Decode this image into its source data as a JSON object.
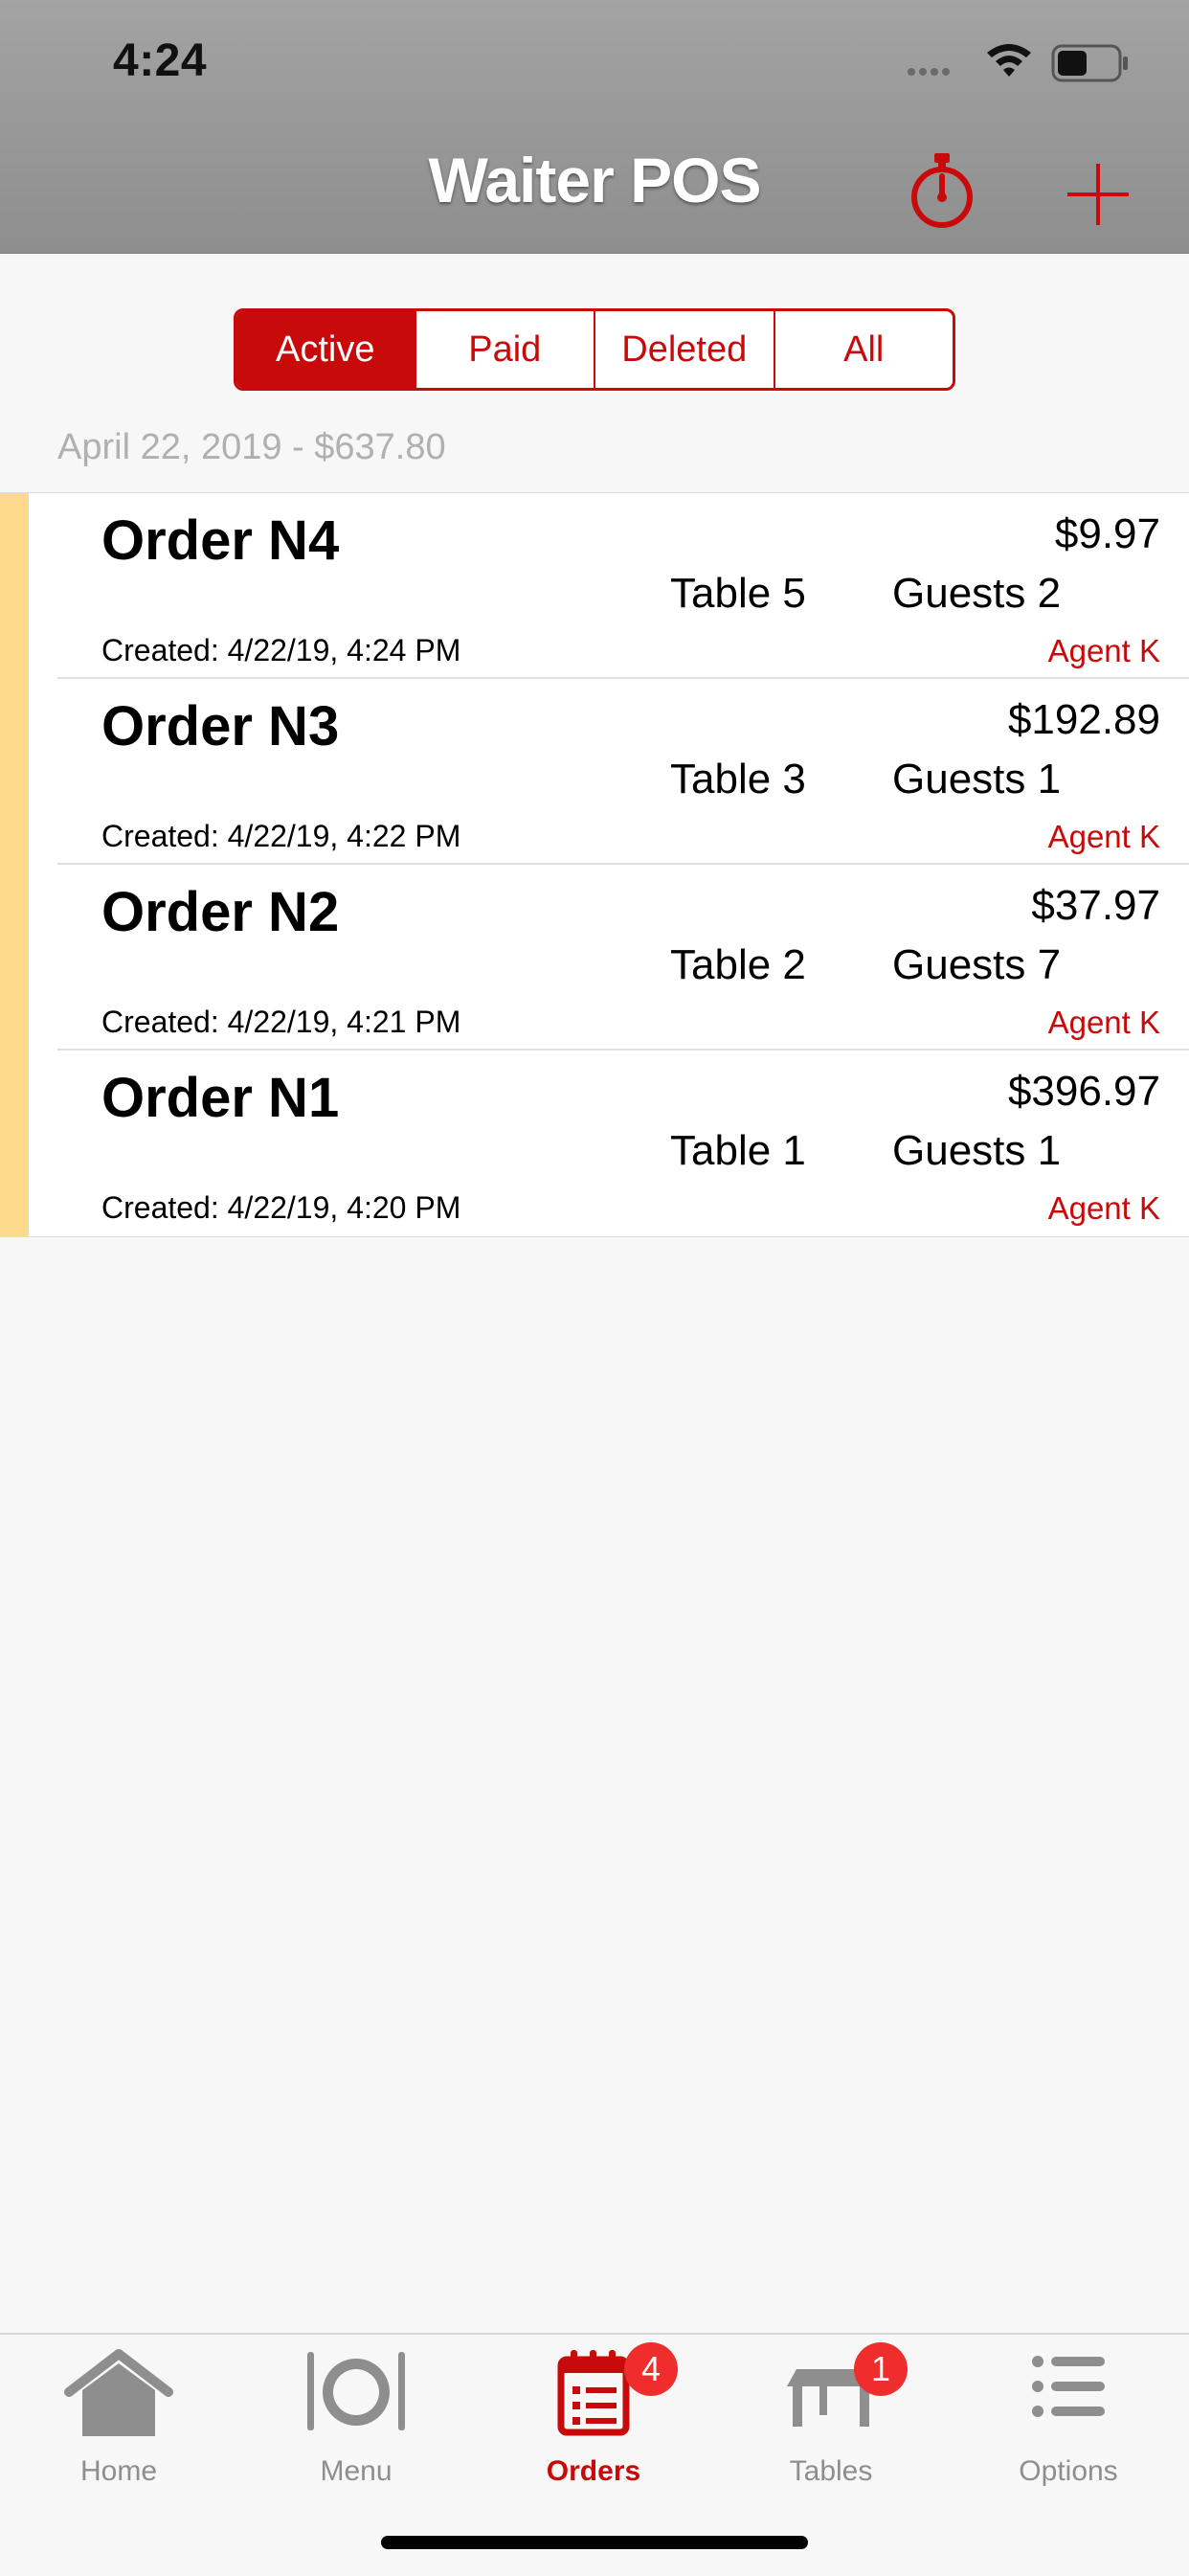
{
  "status_bar": {
    "time": "4:24"
  },
  "nav": {
    "title": "Waiter POS",
    "timer_icon": "stopwatch-icon",
    "add_icon": "plus-icon"
  },
  "segments": [
    {
      "label": "Active",
      "active": true
    },
    {
      "label": "Paid",
      "active": false
    },
    {
      "label": "Deleted",
      "active": false
    },
    {
      "label": "All",
      "active": false
    }
  ],
  "section": {
    "header": "April 22, 2019 - $637.80"
  },
  "orders": [
    {
      "title": "Order N4",
      "price": "$9.97",
      "table": "Table 5",
      "guests": "Guests 2",
      "created": "Created: 4/22/19, 4:24 PM",
      "agent": "Agent K"
    },
    {
      "title": "Order N3",
      "price": "$192.89",
      "table": "Table 3",
      "guests": "Guests 1",
      "created": "Created: 4/22/19, 4:22 PM",
      "agent": "Agent K"
    },
    {
      "title": "Order N2",
      "price": "$37.97",
      "table": "Table 2",
      "guests": "Guests 7",
      "created": "Created: 4/22/19, 4:21 PM",
      "agent": "Agent K"
    },
    {
      "title": "Order N1",
      "price": "$396.97",
      "table": "Table 1",
      "guests": "Guests 1",
      "created": "Created: 4/22/19, 4:20 PM",
      "agent": "Agent K"
    }
  ],
  "tabs": [
    {
      "label": "Home",
      "icon": "house-icon"
    },
    {
      "label": "Menu",
      "icon": "plate-cutlery-icon"
    },
    {
      "label": "Orders",
      "icon": "notepad-icon",
      "badge": "4",
      "active": true
    },
    {
      "label": "Tables",
      "icon": "table-icon",
      "badge": "1"
    },
    {
      "label": "Options",
      "icon": "list-icon"
    }
  ],
  "colors": {
    "accent": "#c80a0a",
    "order_stripe": "#fcd98b",
    "badge": "#ef2d2d",
    "inactive_tab": "#8e8e8e"
  }
}
